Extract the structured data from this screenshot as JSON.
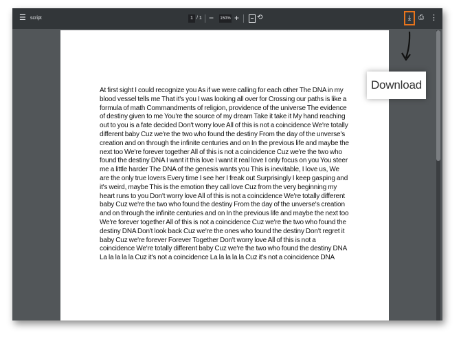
{
  "toolbar": {
    "menu_icon": "hamburger-icon",
    "title": "script",
    "page_current": "1",
    "page_sep_total": "/ 1",
    "zoom_out": "−",
    "zoom_value": "150%",
    "zoom_in": "+",
    "fit_icon": "fit-page-icon",
    "rotate_icon": "rotate-icon",
    "download_icon": "download-icon",
    "print_icon": "print-icon",
    "more_icon": "more-vert-icon",
    "highlight_color": "#e8741c"
  },
  "document": {
    "body_text": "At first sight I could recognize you As if we were calling for each other The DNA in my blood vessel tells me That it's you I was looking all over for Crossing our paths is like a formula of math Commandments of religion, providence of the universe The evidence of destiny given to me You're the source of my dream Take it take it My hand reaching out to you is a fate decided Don't worry love All of this is not a coincidence We're totally different baby Cuz we're the two who found the destiny From the day of the unverse's creation and on through the infinite centuries and on In the previous life and maybe the next too We're forever together All of this is not a coincidence Cuz we're the two who found the destiny DNA I want it this love I want it real love I only focus on you You steer me a little harder The DNA of the genesis wants you This is inevitable, I love us, We are the only true lovers Every time I see her I freak out Surprisingly I keep gasping and it's weird, maybe This is the emotion they call love Cuz from the very beginning my heart runs to you Don't worry love All of this is not a coincidence We're totally different baby Cuz we're the two who found the destiny From the day of the unverse's creation and on through the infinite centuries and on In the previous life and maybe the next too We're forever together All of this is not a coincidence Cuz we're the two who found the destiny DNA Don't look back Cuz we're the ones who found the destiny Don't regret it baby Cuz we're forever Forever Together Don't worry love All of this is not a coincidence We're totally different baby Cuz we're the two who found the destiny DNA La la la la la Cuz it's not a coincidence La la la la la Cuz it's not a coincidence DNA"
  },
  "annotation": {
    "callout_label": "Download"
  }
}
